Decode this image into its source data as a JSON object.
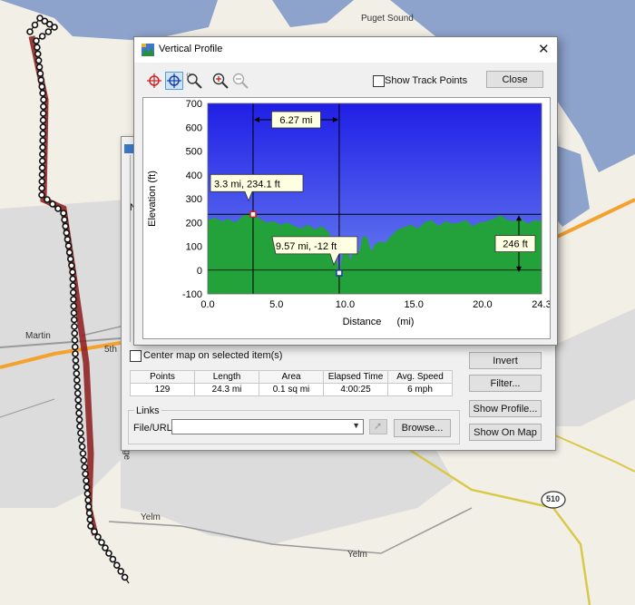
{
  "map": {
    "labels": {
      "puget_sound": "Puget Sound",
      "martin": "Martin",
      "fifth": "5th",
      "yelm1": "Yelm",
      "yelm2": "Yelm",
      "route510": "510",
      "ge": "ge"
    }
  },
  "profile_window": {
    "title": "Vertical Profile",
    "show_track_points_label": "Show Track Points",
    "show_track_points_checked": false,
    "close_label": "Close",
    "tools": [
      "crosshair-red-icon",
      "crosshair-blue-icon",
      "zoom-area-icon",
      "zoom-in-icon",
      "zoom-out-icon"
    ]
  },
  "chart_data": {
    "type": "area",
    "xlabel": "Distance",
    "xunit": "(mi)",
    "ylabel": "Elevation (ft)",
    "xlim": [
      0,
      24.3
    ],
    "ylim": [
      -100,
      700
    ],
    "xticks": [
      "0.0",
      "5.0",
      "10.0",
      "15.0",
      "20.0",
      "24.3"
    ],
    "yticks": [
      "700",
      "600",
      "500",
      "400",
      "300",
      "200",
      "100",
      "0",
      "-100"
    ],
    "x": [
      0,
      0.5,
      1.0,
      1.5,
      2.0,
      2.5,
      3.0,
      3.3,
      3.8,
      4.3,
      4.8,
      5.3,
      5.8,
      6.3,
      6.8,
      7.3,
      7.8,
      8.3,
      8.8,
      9.1,
      9.3,
      9.57,
      9.8,
      10.1,
      10.4,
      10.7,
      11.0,
      11.3,
      11.6,
      11.9,
      12.2,
      12.5,
      12.9,
      13.3,
      13.8,
      14.3,
      14.8,
      15.3,
      15.8,
      16.3,
      16.8,
      17.3,
      17.8,
      18.3,
      18.8,
      19.3,
      19.8,
      20.3,
      20.8,
      21.3,
      21.8,
      22.3,
      22.8,
      23.3,
      23.8,
      24.3
    ],
    "y": [
      210,
      220,
      205,
      215,
      200,
      225,
      240,
      234,
      215,
      200,
      205,
      190,
      200,
      185,
      175,
      190,
      170,
      185,
      160,
      120,
      70,
      -12,
      60,
      110,
      40,
      110,
      70,
      145,
      135,
      80,
      110,
      120,
      115,
      140,
      170,
      180,
      190,
      175,
      200,
      210,
      185,
      205,
      195,
      200,
      210,
      185,
      200,
      205,
      215,
      230,
      210,
      205,
      215,
      195,
      210,
      205
    ],
    "annotations": {
      "point1_label": "3.3 mi, 234.1 ft",
      "point1": {
        "x": 3.3,
        "y": 234.1
      },
      "point2_label": "9.57 mi, -12 ft",
      "point2": {
        "x": 9.57,
        "y": -12
      },
      "distance_label": "6.27 mi",
      "elevation_diff_label": "246 ft"
    }
  },
  "track_window": {
    "center_map_label": "Center map on selected item(s)",
    "stats_headers": [
      "Points",
      "Length",
      "Area",
      "Elapsed Time",
      "Avg. Speed"
    ],
    "stats_values": [
      "129",
      "24.3 mi",
      "0.1 sq mi",
      "4:00:25",
      "6 mph"
    ],
    "links_label": "Links",
    "file_url_label": "File/URL:",
    "file_url_value": "",
    "browse_label": "Browse...",
    "invert_label": "Invert",
    "filter_label": "Filter...",
    "show_profile_label": "Show Profile...",
    "show_on_map_label": "Show On Map",
    "edge_letter": "N"
  },
  "colors": {
    "water": "#8da3cc",
    "land": "#f2efe6",
    "urban": "#dcdcdc",
    "highway": "#f4a22d",
    "road": "#f5efb0",
    "track": "#8b1a1a",
    "chart_sky_top": "#1f1fe6",
    "chart_sky_bottom": "#6f86f0",
    "chart_ground": "#23a13a"
  }
}
